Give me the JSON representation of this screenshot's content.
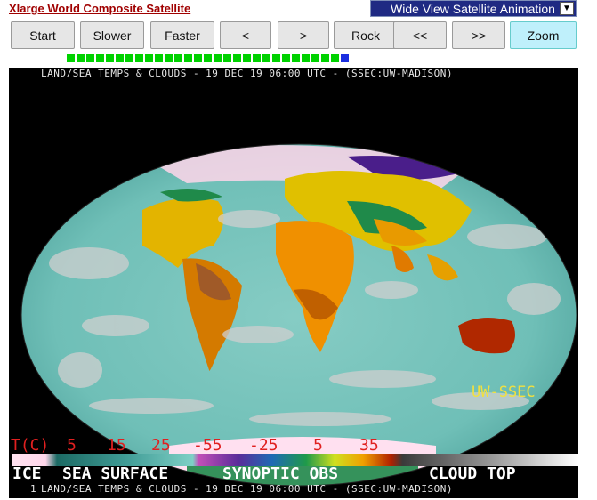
{
  "page": {
    "title_link": "Xlarge World Composite Satellite",
    "view_select": {
      "selected": "Wide View Satellite Animation"
    }
  },
  "toolbar": {
    "start": "Start",
    "slower": "Slower",
    "faster": "Faster",
    "prev": "<",
    "next": ">",
    "rock": "Rock",
    "first": "<<",
    "last": ">>",
    "zoom": "Zoom"
  },
  "frames": {
    "count": 29,
    "current": 29
  },
  "image": {
    "header": "LAND/SEA TEMPS & CLOUDS - 19 DEC 19 06:00 UTC - (SSEC:UW-MADISON)",
    "footer": "LAND/SEA TEMPS & CLOUDS - 19 DEC 19 06:00 UTC - (SSEC:UW-MADISON)",
    "frame_number": "1",
    "brand": "UW-SSEC",
    "legend": {
      "unit": "T(C)",
      "sea_ticks": [
        "5",
        "15",
        "25"
      ],
      "land_ticks": [
        "-55",
        "-25",
        "5",
        "35"
      ],
      "ice": "ICE",
      "sea_surface": "SEA SURFACE",
      "synoptic": "SYNOPTIC OBS",
      "cloud_top": "CLOUD TOP"
    },
    "colors": {
      "ice": "#ffd6ea",
      "ocean": "#79c8c0",
      "land_warm": "#e88a00",
      "land_cool": "#1f8a4a",
      "cloud": "#c8c8c8",
      "brand": "#f0e040",
      "tick_red": "#e02020"
    }
  }
}
